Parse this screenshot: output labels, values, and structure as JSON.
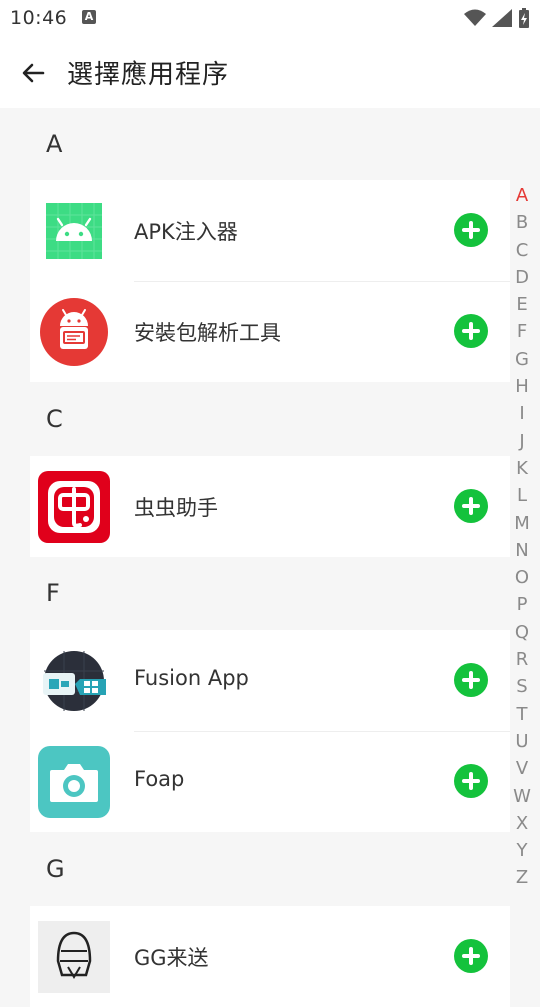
{
  "status_bar": {
    "time": "10:46",
    "notification_icon": "A"
  },
  "app_bar": {
    "title": "選擇應用程序",
    "back_icon": "arrow-left-icon"
  },
  "sections": [
    {
      "letter": "A",
      "apps": [
        {
          "name": "APK注入器",
          "icon": "android-grid-icon"
        },
        {
          "name": "安裝包解析工具",
          "icon": "android-package-icon"
        }
      ]
    },
    {
      "letter": "C",
      "apps": [
        {
          "name": "虫虫助手",
          "icon": "chongchong-icon"
        }
      ]
    },
    {
      "letter": "F",
      "apps": [
        {
          "name": "Fusion App",
          "icon": "fusion-app-icon"
        },
        {
          "name": "Foap",
          "icon": "camera-icon"
        }
      ]
    },
    {
      "letter": "G",
      "apps": [
        {
          "name": "GG来送",
          "icon": "helmet-icon"
        }
      ]
    }
  ],
  "index_letters": [
    "A",
    "B",
    "C",
    "D",
    "E",
    "F",
    "G",
    "H",
    "I",
    "J",
    "K",
    "L",
    "M",
    "N",
    "O",
    "P",
    "Q",
    "R",
    "S",
    "T",
    "U",
    "V",
    "W",
    "X",
    "Y",
    "Z"
  ],
  "active_index": "A",
  "colors": {
    "accent_green": "#14c23c",
    "index_active": "#e53935"
  }
}
